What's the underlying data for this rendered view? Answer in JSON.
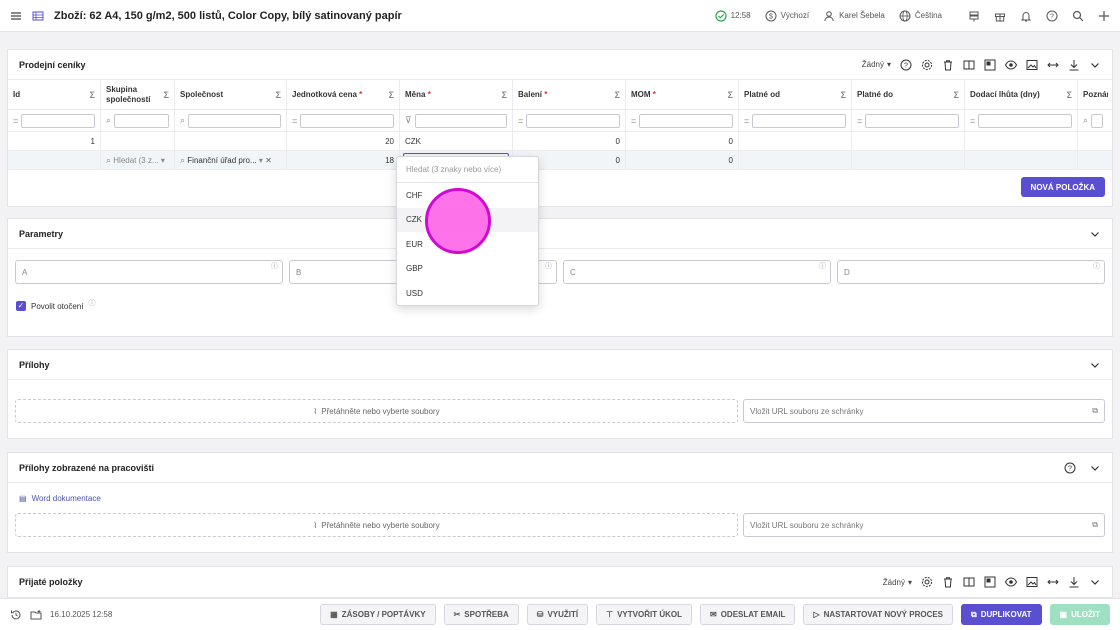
{
  "header": {
    "title": "Zboží: 62 A4, 150 g/m2, 500 listů, Color Copy, bílý satinovaný papír",
    "time": "12:58",
    "profile": "Výchozí",
    "user": "Karel Šebela",
    "language": "Čeština"
  },
  "pricelists": {
    "title": "Prodejní ceníky",
    "view_select": "Žádný",
    "columns": [
      {
        "label": "Id",
        "required": ""
      },
      {
        "label": "Skupina společností",
        "required": ""
      },
      {
        "label": "Společnost",
        "required": ""
      },
      {
        "label": "Jednotková cena",
        "required": "*"
      },
      {
        "label": "Měna",
        "required": "*"
      },
      {
        "label": "Balení",
        "required": "*"
      },
      {
        "label": "MOM",
        "required": "*"
      },
      {
        "label": "Platné od",
        "required": ""
      },
      {
        "label": "Platné do",
        "required": ""
      },
      {
        "label": "Dodací lhůta (dny)",
        "required": ""
      },
      {
        "label": "Poznámk",
        "required": ""
      }
    ],
    "row1": {
      "id": "1",
      "price": "20",
      "currency": "CZK",
      "packaging": "0",
      "mom": "0"
    },
    "row2": {
      "group_placeholder": "Hledat (3 z...",
      "company": "Finanční úřad pro...",
      "price": "18",
      "packaging": "0",
      "mom": "0"
    },
    "new_item": "NOVÁ POLOŽKA"
  },
  "currency_dropdown": {
    "search_placeholder": "Hledat (3 znaky nebo více)",
    "options": [
      "CHF",
      "CZK",
      "EUR",
      "GBP",
      "USD"
    ],
    "highlighted": "CZK"
  },
  "parameters": {
    "title": "Parametry",
    "fields": [
      "A",
      "B",
      "C",
      "D"
    ],
    "allow_rotation_label": "Povolit otočení",
    "allow_rotation_checked": true
  },
  "attachments": {
    "title": "Přílohy",
    "drop_text": "Přetáhněte nebo vyberte soubory",
    "url_placeholder": "Vložit URL souboru ze schránky"
  },
  "workplace_attachments": {
    "title": "Přílohy zobrazené na pracovišti",
    "doc_link": "Word dokumentace",
    "drop_text": "Přetáhněte nebo vyberte soubory",
    "url_placeholder": "Vložit URL souboru ze schránky"
  },
  "received_items": {
    "title": "Přijaté položky",
    "view_select": "Žádný"
  },
  "footer": {
    "date": "16.10.2025 12:58",
    "buttons": {
      "stock": "ZÁSOBY / POPTÁVKY",
      "consumption": "SPOTŘEBA",
      "usage": "VYUŽITÍ",
      "task": "VYTVOŘIT ÚKOL",
      "email": "ODESLAT EMAIL",
      "process": "NASTARTOVAT NOVÝ PROCES",
      "duplicate": "DUPLIKOVAT",
      "save": "ULOŽIT"
    }
  },
  "colors": {
    "accent": "#5a4fd1",
    "save_disabled": "#9fe0c3",
    "check_ok": "#2aa84a"
  }
}
